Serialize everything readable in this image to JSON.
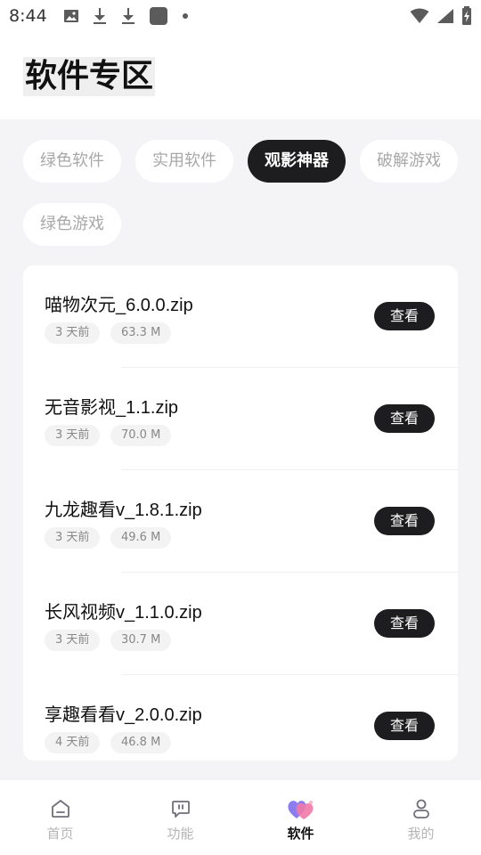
{
  "status_bar": {
    "time": "8:44",
    "left_icons": [
      "image-icon",
      "download-icon",
      "download-icon",
      "app-square-icon",
      "dot-icon"
    ],
    "right_icons": [
      "wifi-icon",
      "signal-icon",
      "battery-charging-icon"
    ]
  },
  "header": {
    "title": "软件专区"
  },
  "categories": [
    {
      "label": "绿色软件",
      "active": false
    },
    {
      "label": "实用软件",
      "active": false
    },
    {
      "label": "观影神器",
      "active": true
    },
    {
      "label": "破解游戏",
      "active": false
    },
    {
      "label": "绿色游戏",
      "active": false
    }
  ],
  "files": [
    {
      "name": "喵物次元_6.0.0.zip",
      "time": "3 天前",
      "size": "63.3 M",
      "button": "查看"
    },
    {
      "name": "无音影视_1.1.zip",
      "time": "3 天前",
      "size": "70.0 M",
      "button": "查看"
    },
    {
      "name": "九龙趣看v_1.8.1.zip",
      "time": "3 天前",
      "size": "49.6 M",
      "button": "查看"
    },
    {
      "name": "长风视频v_1.1.0.zip",
      "time": "3 天前",
      "size": "30.7 M",
      "button": "查看"
    },
    {
      "name": "享趣看看v_2.0.0.zip",
      "time": "4 天前",
      "size": "46.8 M",
      "button": "查看"
    }
  ],
  "bottom_nav": [
    {
      "label": "首页",
      "icon": "home-icon",
      "active": false
    },
    {
      "label": "功能",
      "icon": "function-icon",
      "active": false
    },
    {
      "label": "软件",
      "icon": "heart-software-icon",
      "active": true
    },
    {
      "label": "我的",
      "icon": "profile-icon",
      "active": false
    }
  ],
  "colors": {
    "accent_dark": "#1d1d1f",
    "background": "#f4f4f6",
    "inactive_text": "#a8a8a8",
    "heart_pink": "#f07aa8",
    "heart_purple": "#8b7cf0"
  }
}
